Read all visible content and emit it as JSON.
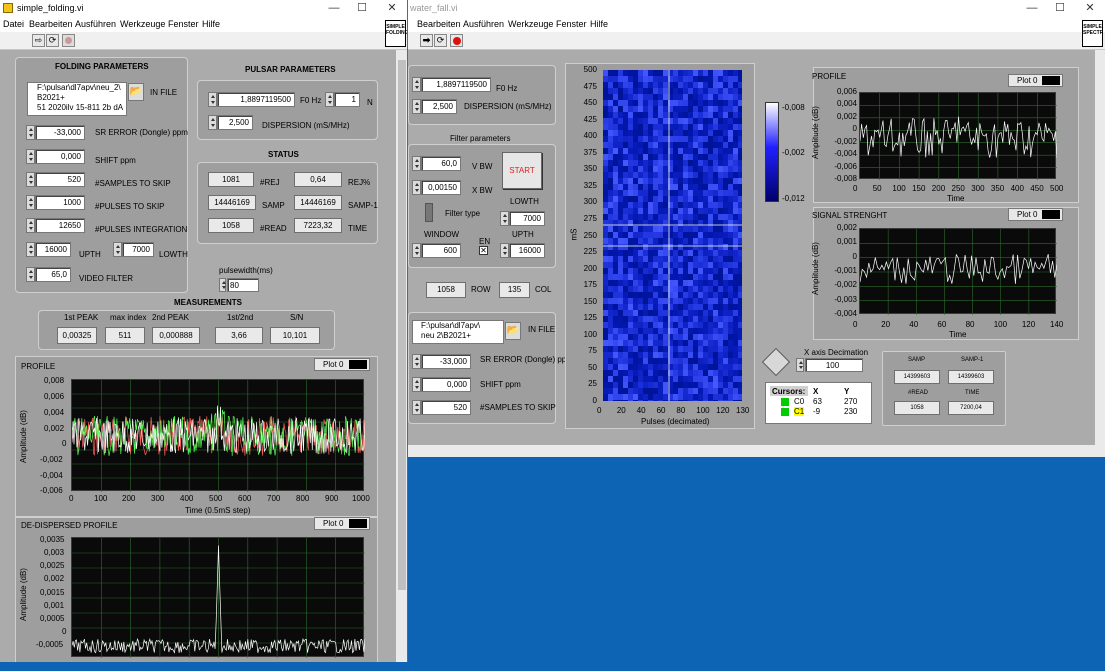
{
  "left": {
    "title": "simple_folding.vi",
    "menu": [
      "Datei",
      "Bearbeiten",
      "Ausführen",
      "Werkzeuge",
      "Fenster",
      "Hilfe"
    ],
    "vi_icon": [
      "SIMPLE",
      "FOLDING"
    ],
    "folding": {
      "header": "FOLDING PARAMETERS",
      "file": [
        "F:\\pulsar\\dl7apv\\neu_2\\",
        "B2021+",
        "51 2020ilv 15-811 2b dA"
      ],
      "in_file": "IN FILE",
      "rows": [
        {
          "v": "-33,000",
          "l": "SR ERROR (Dongle) ppm"
        },
        {
          "v": "0,000",
          "l": "SHIFT ppm"
        },
        {
          "v": "520",
          "l": "#SAMPLES TO SKIP"
        },
        {
          "v": "1000",
          "l": "#PULSES TO SKIP"
        },
        {
          "v": "12650",
          "l": "#PULSES INTEGRATION"
        }
      ],
      "upth": "16000",
      "upth_l": "UPTH",
      "lowth": "7000",
      "lowth_l": "LOWTH",
      "video": "65,0",
      "video_l": "VIDEO FILTER"
    },
    "pulsar": {
      "header": "PULSAR PARAMETERS",
      "f0": "1,8897119500",
      "f0_l": "F0 Hz",
      "n": "1",
      "n_l": "N",
      "disp": "2,500",
      "disp_l": "DISPERSION (mS/MHz)"
    },
    "status": {
      "header": "STATUS",
      "rej": "1081",
      "rej_l": "#REJ",
      "rejp": "0,64",
      "rejp_l": "REJ%",
      "samp": "14446169",
      "samp_l": "SAMP",
      "samp1": "14446169",
      "samp1_l": "SAMP-1",
      "read": "1058",
      "read_l": "#READ",
      "time": "7223,32",
      "time_l": "TIME"
    },
    "pulsewidth": {
      "label": "pulsewidth(ms)",
      "value": "80"
    },
    "meas": {
      "header": "MEASUREMENTS",
      "h1": "1st PEAK",
      "h2": "max index",
      "h3": "2nd PEAK",
      "h4": "1st/2nd",
      "h5": "S/N",
      "v1": "0,00325",
      "v2": "511",
      "v3": "0,000888",
      "v4": "3,66",
      "v5": "10,101"
    },
    "profile": {
      "title": "PROFILE",
      "plot": "Plot 0",
      "ylabel": "Amplitude (dB)",
      "xlabel": "Time (0.5mS step)",
      "yticks": [
        "0,008",
        "0,006",
        "0,004",
        "0,002",
        "0",
        "-0,002",
        "-0,004",
        "-0,006"
      ],
      "xticks": [
        "0",
        "100",
        "200",
        "300",
        "400",
        "500",
        "600",
        "700",
        "800",
        "900",
        "1000"
      ]
    },
    "dedisp": {
      "title": "DE-DISPERSED PROFILE",
      "plot": "Plot 0",
      "ylabel": "Amplitude (dB)",
      "yticks": [
        "0,0035",
        "0,003",
        "0,0025",
        "0,002",
        "0,0015",
        "0,001",
        "0,0005",
        "0",
        "-0,0005"
      ]
    }
  },
  "right": {
    "title": "water_fall.vi",
    "menu": [
      "Bearbeiten",
      "Ausführen",
      "Werkzeuge",
      "Fenster",
      "Hilfe"
    ],
    "vi_icon": [
      "SIMPLE",
      "SPECTR"
    ],
    "f0": "1,8897119500",
    "f0_l": "F0 Hz",
    "disp": "2,500",
    "disp_l": "DISPERSION (mS/MHz)",
    "filter": {
      "header": "Filter parameters",
      "vbw": "60,0",
      "vbw_l": "V BW",
      "xbw": "0,00150",
      "xbw_l": "X BW",
      "start": "START",
      "ftype": "Filter type",
      "lowth_l": "LOWTH",
      "lowth": "7000",
      "window_l": "WINDOW",
      "window": "600",
      "en": "EN",
      "upth_l": "UPTH",
      "upth": "16000"
    },
    "row": "1058",
    "row_l": "ROW",
    "col": "135",
    "col_l": "COL",
    "file": [
      "F:\\pulsar\\dl7apv\\",
      "neu 2\\B2021+"
    ],
    "in_file": "IN FILE",
    "sr": "-33,000",
    "sr_l": "SR ERROR (Dongle) ppm",
    "shift": "0,000",
    "shift_l": "SHIFT ppm",
    "skip": "520",
    "skip_l": "#SAMPLES TO SKIP",
    "waterfall": {
      "ylabel": "mS",
      "xlabel": "Pulses (decimated)",
      "yticks": [
        "500",
        "475",
        "450",
        "425",
        "400",
        "375",
        "350",
        "325",
        "300",
        "275",
        "250",
        "225",
        "200",
        "175",
        "150",
        "125",
        "100",
        "75",
        "50",
        "25",
        "0"
      ],
      "xticks": [
        "0",
        "20",
        "40",
        "60",
        "80",
        "100",
        "120",
        "130"
      ]
    },
    "colorbar": [
      "-0,008",
      "-0,002",
      "-0,012"
    ],
    "profile": {
      "title": "PROFILE",
      "plot": "Plot 0",
      "ylabel": "Amplitude (dB)",
      "xlabel": "Time",
      "yticks": [
        "0,006",
        "0,004",
        "0,002",
        "0",
        "-0,002",
        "-0,004",
        "-0,006",
        "-0,008"
      ],
      "xticks": [
        "0",
        "50",
        "100",
        "150",
        "200",
        "250",
        "300",
        "350",
        "400",
        "450",
        "500"
      ]
    },
    "signal": {
      "title": "SIGNAL STRENGHT",
      "plot": "Plot 0",
      "ylabel": "Amplitude (dB)",
      "xlabel": "Time",
      "yticks": [
        "0,002",
        "0,001",
        "0",
        "-0,001",
        "-0,002",
        "-0,003",
        "-0,004"
      ],
      "xticks": [
        "0",
        "20",
        "40",
        "60",
        "80",
        "100",
        "120",
        "140"
      ]
    },
    "decim": {
      "label": "X axis Decimation",
      "value": "100"
    },
    "cursors": {
      "h": "Cursors:",
      "hx": "X",
      "hy": "Y",
      "c0": "C0",
      "c0x": "63",
      "c0y": "270",
      "c1": "C1",
      "c1x": "-9",
      "c1y": "230"
    },
    "stat": {
      "samp_l": "SAMP",
      "samp1_l": "SAMP-1",
      "samp": "14399603",
      "samp1": "14399603",
      "read_l": "#READ",
      "time_l": "TIME",
      "read": "1058",
      "time": "7200,04"
    }
  }
}
